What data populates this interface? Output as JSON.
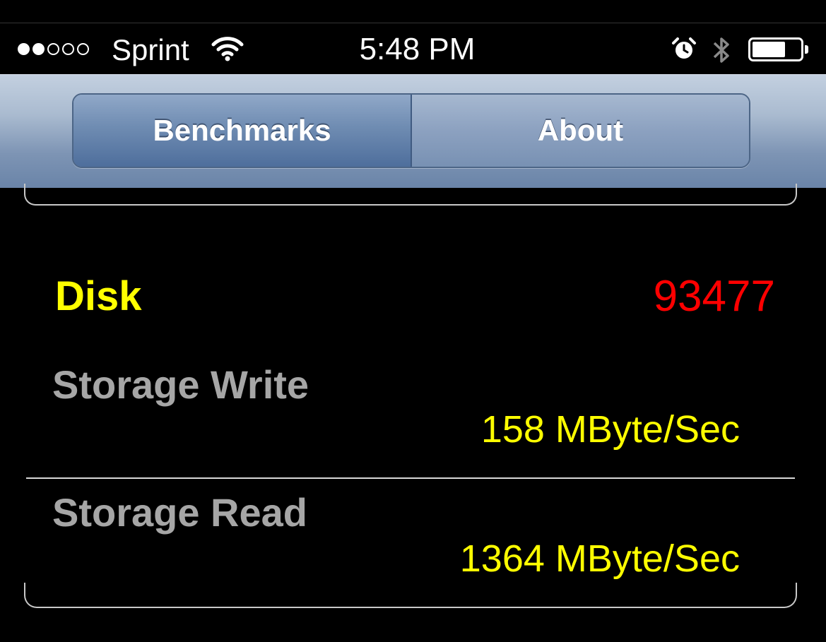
{
  "status_bar": {
    "carrier": "Sprint",
    "time": "5:48 PM",
    "signal_bars_filled": 2,
    "signal_bars_total": 5,
    "icons": [
      "wifi-icon",
      "alarm-icon",
      "bluetooth-icon",
      "battery-icon"
    ],
    "battery_level": 0.7
  },
  "tabs": [
    {
      "label": "Benchmarks",
      "selected": true
    },
    {
      "label": "About",
      "selected": false
    }
  ],
  "disk": {
    "label": "Disk",
    "score": "93477"
  },
  "rows": [
    {
      "label": "Storage Write",
      "value": "158 MByte/Sec"
    },
    {
      "label": "Storage Read",
      "value": "1364 MByte/Sec"
    }
  ],
  "colors": {
    "heading": "#ffff00",
    "score": "#ff0000",
    "row_label": "#a6a6a6",
    "row_value": "#ffff00",
    "nav_active": "#4e6e9c"
  }
}
